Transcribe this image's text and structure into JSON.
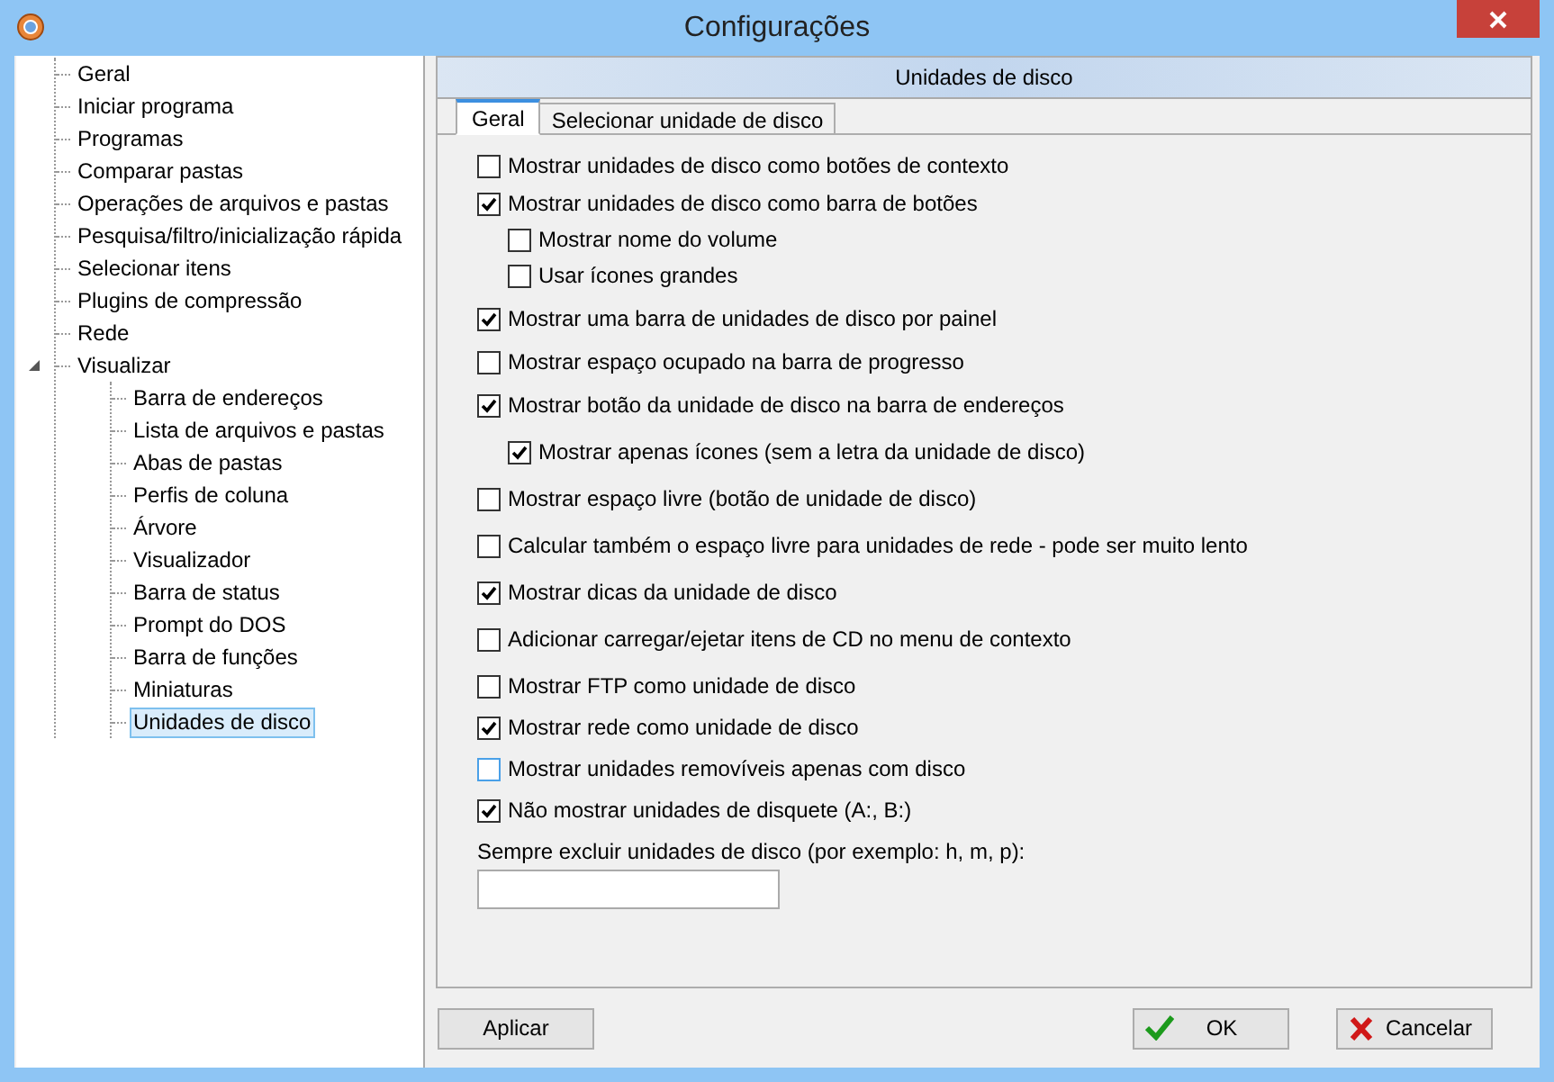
{
  "window": {
    "title": "Configurações"
  },
  "sidebar": {
    "items": [
      {
        "label": "Geral",
        "selected": false
      },
      {
        "label": "Iniciar programa",
        "selected": false
      },
      {
        "label": "Programas",
        "selected": false
      },
      {
        "label": "Comparar pastas",
        "selected": false
      },
      {
        "label": "Operações de arquivos e pastas",
        "selected": false
      },
      {
        "label": "Pesquisa/filtro/inicialização rápida",
        "selected": false
      },
      {
        "label": "Selecionar itens",
        "selected": false
      },
      {
        "label": "Plugins de compressão",
        "selected": false
      },
      {
        "label": "Rede",
        "selected": false
      },
      {
        "label": "Visualizar",
        "selected": false,
        "expanded": true,
        "children": [
          {
            "label": "Barra de endereços",
            "selected": false
          },
          {
            "label": "Lista de arquivos e pastas",
            "selected": false
          },
          {
            "label": "Abas de pastas",
            "selected": false
          },
          {
            "label": "Perfis de coluna",
            "selected": false
          },
          {
            "label": "Árvore",
            "selected": false
          },
          {
            "label": "Visualizador",
            "selected": false
          },
          {
            "label": "Barra de status",
            "selected": false
          },
          {
            "label": "Prompt do DOS",
            "selected": false
          },
          {
            "label": "Barra de funções",
            "selected": false
          },
          {
            "label": "Miniaturas",
            "selected": false
          },
          {
            "label": "Unidades de disco",
            "selected": true
          }
        ]
      }
    ]
  },
  "panel": {
    "title": "Unidades de disco",
    "tabs": [
      {
        "label": "Geral",
        "selected": true
      },
      {
        "label": "Selecionar unidade de disco",
        "selected": false
      }
    ],
    "options": [
      {
        "kind": "checkbox",
        "label": "Mostrar unidades de disco como botões de contexto",
        "checked": false,
        "highlighted": false
      },
      {
        "kind": "checkbox",
        "label": "Mostrar unidades de disco como barra de botões",
        "checked": true,
        "highlighted": false,
        "children": [
          {
            "kind": "checkbox",
            "label": "Mostrar nome do volume",
            "checked": false,
            "highlighted": false
          },
          {
            "kind": "checkbox",
            "label": "Usar ícones grandes",
            "checked": false,
            "highlighted": false
          }
        ]
      },
      {
        "kind": "checkbox",
        "label": "Mostrar uma barra de unidades de disco por painel",
        "checked": true,
        "highlighted": false
      },
      {
        "kind": "checkbox",
        "label": "Mostrar espaço ocupado na barra de progresso",
        "checked": false,
        "highlighted": false
      },
      {
        "kind": "checkbox",
        "label": "Mostrar botão da unidade de disco na barra de endereços",
        "checked": true,
        "highlighted": false,
        "children": [
          {
            "kind": "checkbox",
            "label": "Mostrar apenas ícones (sem a letra da unidade de disco)",
            "checked": true,
            "highlighted": false
          }
        ]
      },
      {
        "kind": "checkbox",
        "label": "Mostrar espaço livre (botão de unidade de disco)",
        "checked": false,
        "highlighted": false
      },
      {
        "kind": "checkbox",
        "label": "Calcular também o espaço livre para unidades de rede - pode ser muito lento",
        "checked": false,
        "highlighted": false
      },
      {
        "kind": "checkbox",
        "label": "Mostrar dicas da unidade de disco",
        "checked": true,
        "highlighted": false
      },
      {
        "kind": "checkbox",
        "label": "Adicionar carregar/ejetar itens de CD no menu de contexto",
        "checked": false,
        "highlighted": false
      },
      {
        "kind": "checkbox",
        "label": "Mostrar FTP como unidade de disco",
        "checked": false,
        "highlighted": false
      },
      {
        "kind": "checkbox",
        "label": "Mostrar rede como unidade de disco",
        "checked": true,
        "highlighted": false
      },
      {
        "kind": "checkbox",
        "label": "Mostrar unidades removíveis apenas com disco",
        "checked": false,
        "highlighted": true
      },
      {
        "kind": "checkbox",
        "label": "Não mostrar unidades de disquete (A:, B:)",
        "checked": true,
        "highlighted": false
      },
      {
        "kind": "field",
        "label": "Sempre excluir unidades de disco (por exemplo: h, m, p):"
      }
    ]
  },
  "buttons": [
    {
      "kind": "apply",
      "label": "Aplicar"
    },
    {
      "kind": "ok",
      "label": "OK"
    },
    {
      "kind": "cancel",
      "label": "Cancelar"
    }
  ]
}
